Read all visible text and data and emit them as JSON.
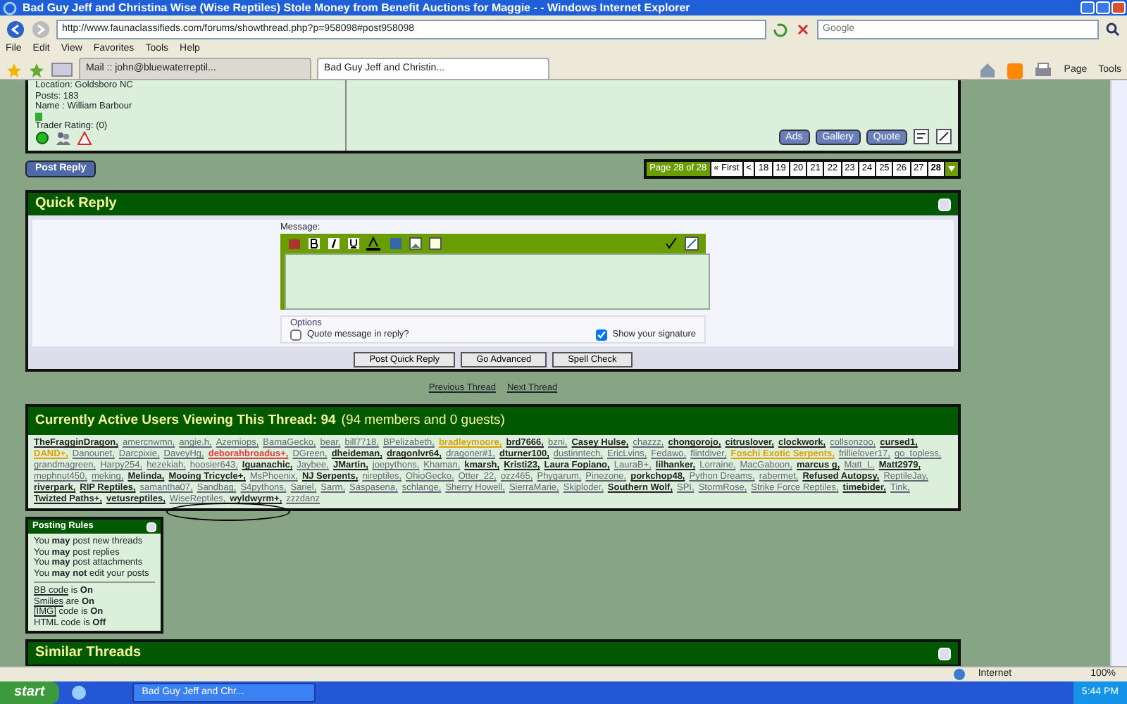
{
  "window": {
    "title": "Bad Guy Jeff and Christina Wise (Wise Reptiles) Stole Money from Benefit Auctions for Maggie - - Windows Internet Explorer"
  },
  "address_bar": {
    "url": "http://www.faunaclassifieds.com/forums/showthread.php?p=958098#post958098"
  },
  "search": {
    "placeholder": "Google"
  },
  "menu": [
    "File",
    "Edit",
    "View",
    "Favorites",
    "Tools",
    "Help"
  ],
  "tabs": [
    {
      "label": "Mail :: john@bluewaterreptil...",
      "selected": false
    },
    {
      "label": "Bad Guy Jeff and Christin...",
      "selected": true
    }
  ],
  "command_bar": [
    "Page",
    "Tools"
  ],
  "post": {
    "profile_lines": [
      "Location: Goldsboro NC",
      "Posts: 183",
      "Name : William Barbour"
    ],
    "trader_rating": "Trader Rating: (0)",
    "online": true,
    "buttons": [
      "Ads",
      "Gallery",
      "Quote"
    ]
  },
  "post_reply_button": "Post Reply",
  "pagination": {
    "label": "Page 28 of 28",
    "first": "« First",
    "prev": "<",
    "pages": [
      {
        "label": "18",
        "selected": false
      },
      {
        "label": "19",
        "selected": false
      },
      {
        "label": "20",
        "selected": false
      },
      {
        "label": "21",
        "selected": false
      },
      {
        "label": "22",
        "selected": false
      },
      {
        "label": "23",
        "selected": false
      },
      {
        "label": "24",
        "selected": false
      },
      {
        "label": "25",
        "selected": false
      },
      {
        "label": "26",
        "selected": false
      },
      {
        "label": "27",
        "selected": false
      },
      {
        "label": "28",
        "selected": true
      }
    ]
  },
  "quick_reply": {
    "title": "Quick Reply",
    "message_label": "Message:",
    "options_legend": "Options",
    "options": [
      {
        "label": "Quote message in reply?",
        "checked": false
      },
      {
        "label": "Show your signature",
        "checked": true
      }
    ],
    "buttons": [
      "Post Quick Reply",
      "Go Advanced",
      "Spell Check"
    ]
  },
  "thread_nav": {
    "previous": "Previous Thread",
    "next": "Next Thread"
  },
  "active_users": {
    "title": "Currently Active Users Viewing This Thread: 94",
    "subtitle": "(94 members and 0 guests)",
    "users": [
      {
        "name": "TheFragginDragon,",
        "kind": "bold"
      },
      {
        "name": "amercnwmn,",
        "kind": "plain"
      },
      {
        "name": "angie.h,",
        "kind": "plain"
      },
      {
        "name": "Azemiops,",
        "kind": "plain"
      },
      {
        "name": "BamaGecko,",
        "kind": "plain"
      },
      {
        "name": "bear,",
        "kind": "plain"
      },
      {
        "name": "bill7718,",
        "kind": "plain"
      },
      {
        "name": "BPelizabeth,",
        "kind": "plain"
      },
      {
        "name": "bradleymoore,",
        "kind": "orange"
      },
      {
        "name": "brd7666,",
        "kind": "bold"
      },
      {
        "name": "bzni,",
        "kind": "plain"
      },
      {
        "name": "Casey Hulse,",
        "kind": "bold"
      },
      {
        "name": "chazzz,",
        "kind": "plain"
      },
      {
        "name": "chongorojo,",
        "kind": "bold"
      },
      {
        "name": "citruslover,",
        "kind": "bold"
      },
      {
        "name": "clockwork,",
        "kind": "bold"
      },
      {
        "name": "collsonzoo,",
        "kind": "plain"
      },
      {
        "name": "cursed1,",
        "kind": "bold"
      },
      {
        "name": "DAND+,",
        "kind": "orange"
      },
      {
        "name": "Danounet,",
        "kind": "plain"
      },
      {
        "name": "Darcpixie,",
        "kind": "plain"
      },
      {
        "name": "DaveyHg,",
        "kind": "plain"
      },
      {
        "name": "deborahbroadus+,",
        "kind": "red"
      },
      {
        "name": "DGreen,",
        "kind": "plain"
      },
      {
        "name": "dheideman,",
        "kind": "bold"
      },
      {
        "name": "dragonlvr64,",
        "kind": "bold"
      },
      {
        "name": "dragoner#1,",
        "kind": "plain"
      },
      {
        "name": "dturner100,",
        "kind": "bold"
      },
      {
        "name": "dustinntech,",
        "kind": "plain"
      },
      {
        "name": "EricLvins,",
        "kind": "plain"
      },
      {
        "name": "Fedawo,",
        "kind": "plain"
      },
      {
        "name": "flintdiver,",
        "kind": "plain"
      },
      {
        "name": "Foschi Exotic Serpents,",
        "kind": "orange"
      },
      {
        "name": "frillielover17,",
        "kind": "plain"
      },
      {
        "name": "go_topless,",
        "kind": "plain"
      },
      {
        "name": "grandmagreen,",
        "kind": "plain"
      },
      {
        "name": "Harpy254,",
        "kind": "plain"
      },
      {
        "name": "hezekiah,",
        "kind": "plain"
      },
      {
        "name": "hoosier643,",
        "kind": "plain"
      },
      {
        "name": "Iguanachic,",
        "kind": "bold"
      },
      {
        "name": "Jaybee,",
        "kind": "plain"
      },
      {
        "name": "JMartin,",
        "kind": "bold"
      },
      {
        "name": "joepythons,",
        "kind": "plain"
      },
      {
        "name": "Khaman,",
        "kind": "plain"
      },
      {
        "name": "kmarsh,",
        "kind": "bold"
      },
      {
        "name": "Kristi23,",
        "kind": "bold"
      },
      {
        "name": "Laura Fopiano,",
        "kind": "bold"
      },
      {
        "name": "LauraB+,",
        "kind": "plain"
      },
      {
        "name": "lilhanker,",
        "kind": "bold"
      },
      {
        "name": "Lorraine,",
        "kind": "plain"
      },
      {
        "name": "MacGaboon,",
        "kind": "plain"
      },
      {
        "name": "marcus g,",
        "kind": "bold"
      },
      {
        "name": "Matt_L,",
        "kind": "plain"
      },
      {
        "name": "Matt2979,",
        "kind": "bold"
      },
      {
        "name": "mephnut450,",
        "kind": "plain"
      },
      {
        "name": "meking,",
        "kind": "plain"
      },
      {
        "name": "Melinda,",
        "kind": "bold"
      },
      {
        "name": "Mooing Tricycle+,",
        "kind": "bold"
      },
      {
        "name": "MsPhoenix,",
        "kind": "plain"
      },
      {
        "name": "NJ Serpents,",
        "kind": "bold"
      },
      {
        "name": "nireptiles,",
        "kind": "plain"
      },
      {
        "name": "OhioGecko,",
        "kind": "plain"
      },
      {
        "name": "Otter_22,",
        "kind": "plain"
      },
      {
        "name": "ozz465,",
        "kind": "plain"
      },
      {
        "name": "Phygarum,",
        "kind": "plain"
      },
      {
        "name": "Pinezone,",
        "kind": "plain"
      },
      {
        "name": "porkchop48,",
        "kind": "bold"
      },
      {
        "name": "Python Dreams,",
        "kind": "plain"
      },
      {
        "name": "rabermet,",
        "kind": "plain"
      },
      {
        "name": "Refused Autopsy,",
        "kind": "bold"
      },
      {
        "name": "ReptileJay,",
        "kind": "plain"
      },
      {
        "name": "riverpark,",
        "kind": "bold"
      },
      {
        "name": "RIP Reptiles,",
        "kind": "bold"
      },
      {
        "name": "samantha07,",
        "kind": "plain"
      },
      {
        "name": "Sandbag,",
        "kind": "plain"
      },
      {
        "name": "S4pythons,",
        "kind": "plain"
      },
      {
        "name": "Sariel,",
        "kind": "plain"
      },
      {
        "name": "Sarm,",
        "kind": "plain"
      },
      {
        "name": "Saspasena,",
        "kind": "plain"
      },
      {
        "name": "schlange,",
        "kind": "plain"
      },
      {
        "name": "Sherry Howell,",
        "kind": "plain"
      },
      {
        "name": "SierraMarie,",
        "kind": "plain"
      },
      {
        "name": "Skiploder,",
        "kind": "plain"
      },
      {
        "name": "Southern Wolf,",
        "kind": "bold"
      },
      {
        "name": "SPI,",
        "kind": "plain"
      },
      {
        "name": "StormRose,",
        "kind": "plain"
      },
      {
        "name": "Strike Force Reptiles,",
        "kind": "plain"
      },
      {
        "name": "timebider,",
        "kind": "bold"
      },
      {
        "name": "Tink,",
        "kind": "plain"
      },
      {
        "name": "Twizted Paths+,",
        "kind": "bold"
      },
      {
        "name": "vetusreptiles,",
        "kind": "bold"
      },
      {
        "name": "WiseReptiles,",
        "kind": "plain"
      },
      {
        "name": "wyldwyrm+,",
        "kind": "bold"
      },
      {
        "name": "zzzdanz",
        "kind": "plain"
      }
    ]
  },
  "posting_rules": {
    "title": "Posting Rules",
    "rules": [
      "You **may** post new threads",
      "You **may** post replies",
      "You **may** post attachments",
      "You **may not** edit your posts"
    ],
    "settings": [
      {
        "link": "BB code",
        "rest": " is **On**"
      },
      {
        "link": "Smilies",
        "rest": " are **On**"
      },
      {
        "link": "[IMG]",
        "rest": " code is **On**"
      },
      {
        "rest": "HTML code is **Off**"
      }
    ]
  },
  "similar_threads": {
    "title": "Similar Threads"
  },
  "status_bar": {
    "zone": "Internet",
    "zoom": "100%"
  },
  "taskbar": {
    "start": "start",
    "task": "Bad Guy Jeff and Chr...",
    "clock": "5:44 PM"
  }
}
